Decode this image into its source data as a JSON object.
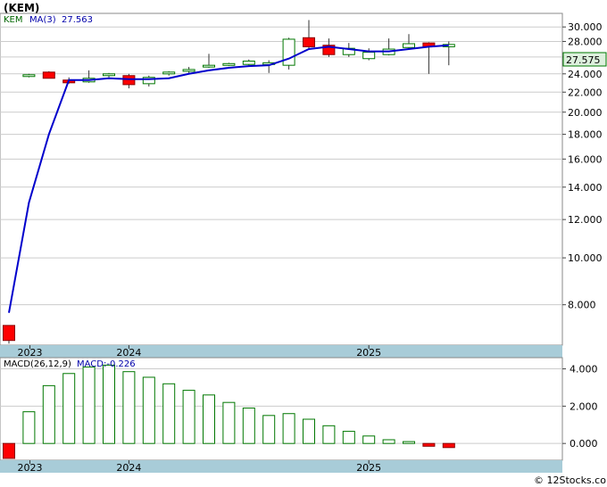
{
  "chart_data": [
    {
      "type": "candlestick",
      "title": "(KEM)",
      "legend": {
        "symbol": "KEM",
        "ma_label": "MA(3)",
        "ma_value": "27.563"
      },
      "last_price_tag": "27.575",
      "y_scale": "log",
      "ylim": [
        6.6,
        32.0
      ],
      "y_ticks": [
        "30.000",
        "28.000",
        "26.000",
        "24.000",
        "22.000",
        "20.000",
        "18.000",
        "16.000",
        "14.000",
        "12.000",
        "10.000",
        "8.000"
      ],
      "x_labels": [
        "2023",
        "2024",
        "2025"
      ],
      "candles": [
        {
          "o": 7.25,
          "h": 7.25,
          "l": 6.65,
          "c": 6.75
        },
        {
          "o": 23.7,
          "h": 24.0,
          "l": 23.6,
          "c": 23.9
        },
        {
          "o": 24.2,
          "h": 24.3,
          "l": 23.5,
          "c": 23.5
        },
        {
          "o": 23.3,
          "h": 23.6,
          "l": 22.9,
          "c": 23.0
        },
        {
          "o": 23.1,
          "h": 24.4,
          "l": 23.0,
          "c": 23.5
        },
        {
          "o": 23.8,
          "h": 24.1,
          "l": 23.6,
          "c": 24.0
        },
        {
          "o": 23.8,
          "h": 24.0,
          "l": 22.4,
          "c": 22.8
        },
        {
          "o": 22.9,
          "h": 23.8,
          "l": 22.6,
          "c": 23.6
        },
        {
          "o": 24.0,
          "h": 24.3,
          "l": 23.8,
          "c": 24.2
        },
        {
          "o": 24.4,
          "h": 24.8,
          "l": 24.1,
          "c": 24.5
        },
        {
          "o": 24.8,
          "h": 26.4,
          "l": 24.7,
          "c": 25.0
        },
        {
          "o": 25.0,
          "h": 25.3,
          "l": 24.9,
          "c": 25.2
        },
        {
          "o": 25.1,
          "h": 25.7,
          "l": 25.0,
          "c": 25.5
        },
        {
          "o": 25.2,
          "h": 25.6,
          "l": 24.1,
          "c": 25.3
        },
        {
          "o": 25.0,
          "h": 28.5,
          "l": 24.5,
          "c": 28.3
        },
        {
          "o": 28.5,
          "h": 31.0,
          "l": 27.0,
          "c": 27.3
        },
        {
          "o": 27.5,
          "h": 28.4,
          "l": 26.0,
          "c": 26.3
        },
        {
          "o": 26.3,
          "h": 27.8,
          "l": 26.0,
          "c": 27.1
        },
        {
          "o": 25.8,
          "h": 27.1,
          "l": 25.6,
          "c": 26.6
        },
        {
          "o": 26.3,
          "h": 28.4,
          "l": 26.2,
          "c": 27.0
        },
        {
          "o": 27.2,
          "h": 29.0,
          "l": 27.0,
          "c": 27.7
        },
        {
          "o": 27.8,
          "h": 27.9,
          "l": 24.0,
          "c": 27.3
        },
        {
          "o": 27.3,
          "h": 28.0,
          "l": 25.0,
          "c": 27.6
        }
      ],
      "ma": [
        7.7,
        13.0,
        18.0,
        23.3,
        23.3,
        23.5,
        23.4,
        23.4,
        23.5,
        24.0,
        24.4,
        24.7,
        24.9,
        25.0,
        25.8,
        27.0,
        27.3,
        27.0,
        26.7,
        26.7,
        27.0,
        27.3,
        27.5
      ]
    },
    {
      "type": "bar",
      "title": "MACD(26,12,9)",
      "value_label": "MACD:-0.226",
      "ylim": [
        -0.9,
        4.6
      ],
      "y_ticks": [
        "4.000",
        "2.000",
        "0.000"
      ],
      "x_labels": [
        "2023",
        "2024",
        "2025"
      ],
      "values": [
        -0.8,
        1.7,
        3.1,
        3.75,
        4.1,
        4.2,
        3.85,
        3.55,
        3.2,
        2.85,
        2.6,
        2.2,
        1.9,
        1.5,
        1.6,
        1.3,
        0.95,
        0.65,
        0.4,
        0.2,
        0.1,
        -0.15,
        -0.22
      ]
    }
  ],
  "credit": "© 12Stocks.com",
  "colors": {
    "up": "#ffffff",
    "down": "#ff0000",
    "body_stroke": "#007700",
    "ma_line": "#0000cc",
    "x_band": "#a8ccd8",
    "bg": "#ffffff"
  }
}
